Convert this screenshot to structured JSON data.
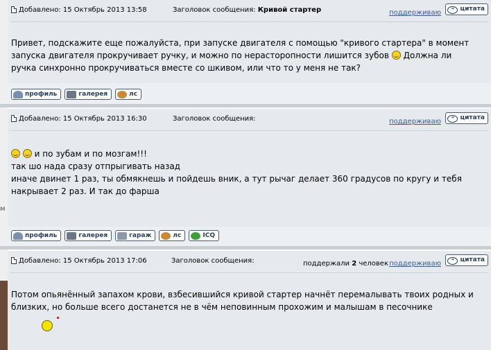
{
  "posts": [
    {
      "added_label": "Добавлено: 15 Октябрь 2013 13:58",
      "subject_label": "Заголовок сообщения:",
      "subject": "Кривой стартер",
      "support_link": "поддерживаю",
      "quote_button": "цитата",
      "text_line1": "Привет, подскажите еще пожалуйста, при запуске двигателя с помощью \"кривого стартера\" в момент",
      "text_line2": "запуска двигателя прокручивает ручку, и можно по нерасторопности лишится зубов",
      "text_line2b": "Должна ли",
      "text_line3": "ручка синхронно прокручиваться вместе со шкивом, или что то у меня не так?",
      "buttons": {
        "profile": "профиль",
        "gallery": "галерея",
        "pm": "лс"
      }
    },
    {
      "added_label": "Добавлено: 15 Октябрь 2013 16:30",
      "subject_label": "Заголовок сообщения:",
      "support_link": "поддерживаю",
      "quote_button": "цитата",
      "text_line1": "и по зубам и по мозгам!!!",
      "text_line2": "так шо нада сразу отпрыгивать назад",
      "text_line3": "иначе двинет 1 раз, ты обмякнешь и пойдешь вник, а тут рычаг делает 360 градусов по кругу и тебя",
      "text_line4": "накрывает 2 раз. И так до фарша",
      "buttons": {
        "profile": "профиль",
        "gallery": "галерея",
        "garage": "гараж",
        "pm": "лс",
        "icq": "ICQ"
      }
    },
    {
      "added_label": "Добавлено: 15 Октябрь 2013 17:06",
      "subject_label": "Заголовок сообщения:",
      "supported_prefix": "поддержали",
      "supported_count": "2",
      "supported_suffix": "человек",
      "support_link": "поддерживаю",
      "quote_button": "цитата",
      "text_line1": "Потом опьянённый запахом крови, взбесившийся кривой стартер начнёт перемалывать твоих родных и",
      "text_line2": "близких, но больше всего достанется не в чём неповинным прохожим и малышам в песочнике"
    }
  ],
  "left_fragment": "м"
}
